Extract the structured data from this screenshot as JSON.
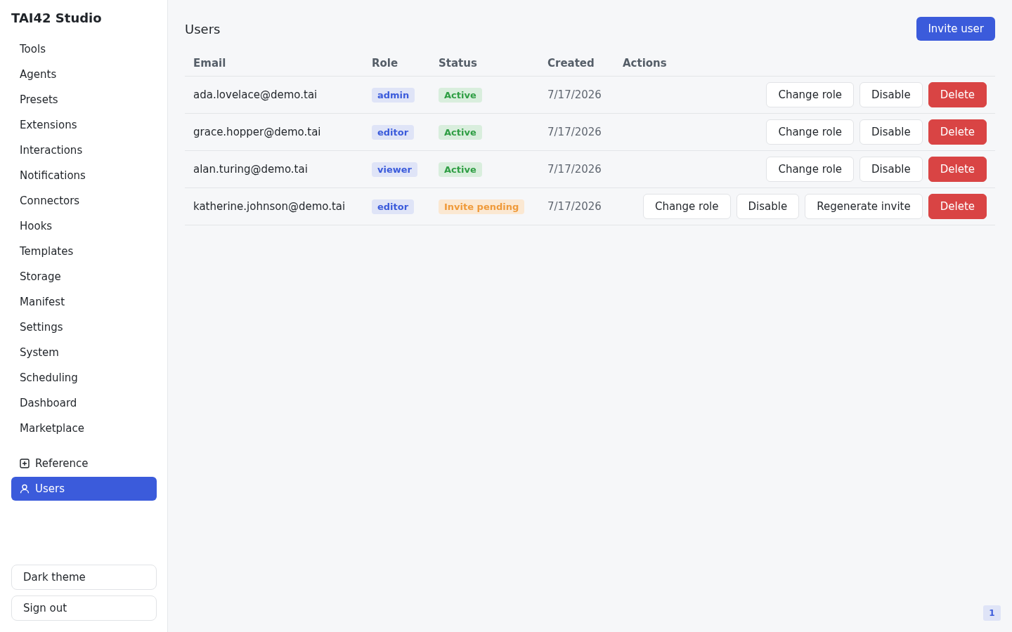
{
  "sidebar": {
    "title": "TAI42 Studio",
    "items": [
      {
        "label": "Tools",
        "selected": false
      },
      {
        "label": "Agents",
        "selected": false
      },
      {
        "label": "Presets",
        "selected": false
      },
      {
        "label": "Extensions",
        "selected": false
      },
      {
        "label": "Interactions",
        "selected": false
      },
      {
        "label": "Notifications",
        "selected": false
      },
      {
        "label": "Connectors",
        "selected": false
      },
      {
        "label": "Hooks",
        "selected": false
      },
      {
        "label": "Templates",
        "selected": false
      },
      {
        "label": "Storage",
        "selected": false
      },
      {
        "label": "Manifest",
        "selected": false
      },
      {
        "label": "Settings",
        "selected": false
      },
      {
        "label": "System",
        "selected": false
      },
      {
        "label": "Scheduling",
        "selected": false
      },
      {
        "label": "Dashboard",
        "selected": false
      },
      {
        "label": "Marketplace",
        "selected": false
      }
    ],
    "pinned": [
      {
        "label": "Reference",
        "kind": "reference",
        "selected": false
      },
      {
        "label": "Users",
        "kind": "users",
        "selected": true
      }
    ],
    "footer_buttons": [
      "Dark theme",
      "Sign out"
    ]
  },
  "main": {
    "title": "Users",
    "invite_button": "Invite user",
    "table": {
      "columns": [
        "Email",
        "Role",
        "Status",
        "Created",
        "Actions"
      ],
      "rows": [
        {
          "email": "ada.lovelace@demo.tai",
          "role": "admin",
          "status": {
            "label": "Active",
            "kind": "active"
          },
          "created": "7/17/2026",
          "actions": [
            {
              "label": "Change role",
              "kind": "default"
            },
            {
              "label": "Disable",
              "kind": "default"
            },
            {
              "label": "Delete",
              "kind": "danger"
            }
          ]
        },
        {
          "email": "grace.hopper@demo.tai",
          "role": "editor",
          "status": {
            "label": "Active",
            "kind": "active"
          },
          "created": "7/17/2026",
          "actions": [
            {
              "label": "Change role",
              "kind": "default"
            },
            {
              "label": "Disable",
              "kind": "default"
            },
            {
              "label": "Delete",
              "kind": "danger"
            }
          ]
        },
        {
          "email": "alan.turing@demo.tai",
          "role": "viewer",
          "status": {
            "label": "Active",
            "kind": "active"
          },
          "created": "7/17/2026",
          "actions": [
            {
              "label": "Change role",
              "kind": "default"
            },
            {
              "label": "Disable",
              "kind": "default"
            },
            {
              "label": "Delete",
              "kind": "danger"
            }
          ]
        },
        {
          "email": "katherine.johnson@demo.tai",
          "role": "editor",
          "status": {
            "label": "Invite pending",
            "kind": "pending"
          },
          "created": "7/17/2026",
          "actions": [
            {
              "label": "Change role",
              "kind": "default"
            },
            {
              "label": "Disable",
              "kind": "default"
            },
            {
              "label": "Regenerate invite",
              "kind": "default"
            },
            {
              "label": "Delete",
              "kind": "danger"
            }
          ]
        }
      ]
    }
  },
  "corner_badge": "1"
}
